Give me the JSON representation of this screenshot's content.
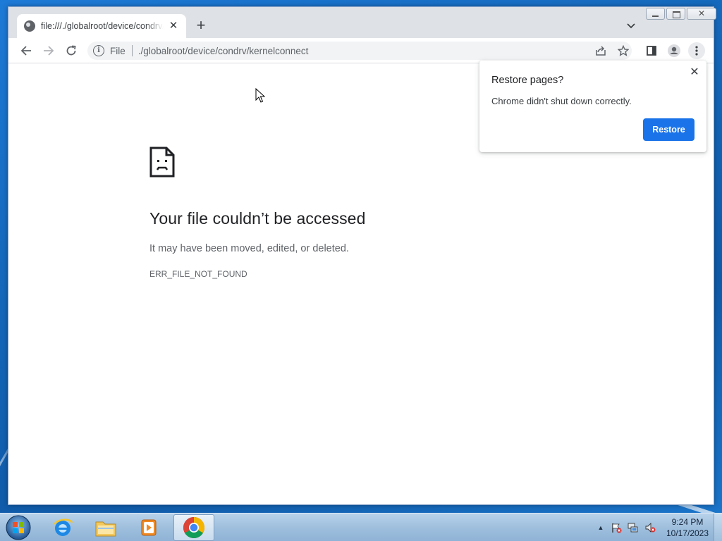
{
  "browser": {
    "tab": {
      "title": "file:///./globalroot/device/condrv/kernelconnect"
    },
    "omnibox": {
      "scheme_chip": "File",
      "url": "./globalroot/device/condrv/kernelconnect"
    }
  },
  "error_page": {
    "title": "Your file couldn’t be accessed",
    "description": "It may have been moved, edited, or deleted.",
    "code": "ERR_FILE_NOT_FOUND"
  },
  "restore_popup": {
    "title": "Restore pages?",
    "message": "Chrome didn't shut down correctly.",
    "restore_label": "Restore"
  },
  "taskbar": {
    "clock_time": "9:24 PM",
    "clock_date": "10/17/2023"
  },
  "colors": {
    "accent": "#1a73e8",
    "desktop": "#1466b8",
    "taskbar": "#9fbfdd"
  }
}
